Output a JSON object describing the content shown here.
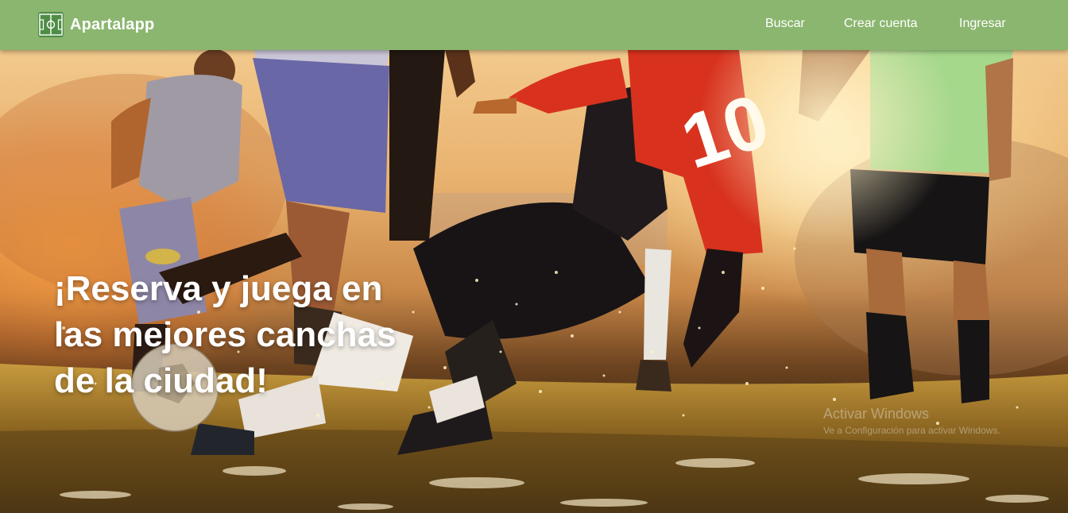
{
  "navbar": {
    "brand_name": "Apartalapp",
    "brand_icon": "soccer-field-icon",
    "links": {
      "buscar": "Buscar",
      "crear_cuenta": "Crear cuenta",
      "ingresar": "Ingresar"
    }
  },
  "hero": {
    "title": "¡Reserva y juega en las mejores canchas de la ciudad!",
    "jersey_number": "10"
  },
  "watermark": {
    "title": "Activar Windows",
    "subtitle": "Ve a Configuración para activar Windows."
  },
  "colors": {
    "navbar": "#8bb66f",
    "text": "#ffffff",
    "jersey_red": "#d8321e"
  }
}
